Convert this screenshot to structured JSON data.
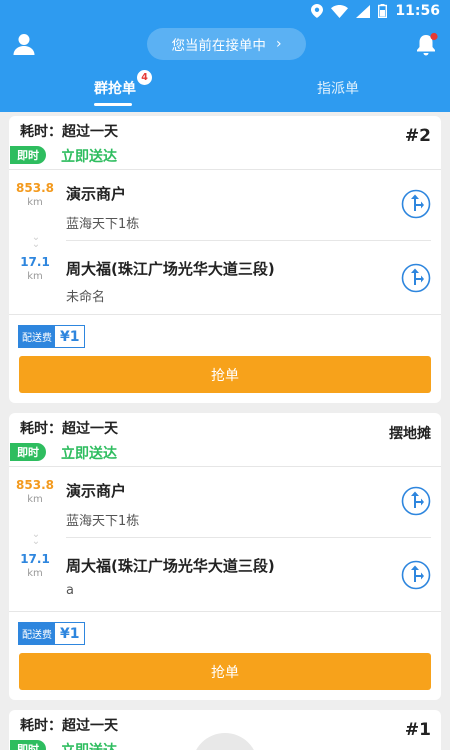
{
  "status_bar": {
    "time": "11:56"
  },
  "header": {
    "pill_text": "您当前在接单中",
    "tabs": [
      {
        "label": "群抢单",
        "badge": "4"
      },
      {
        "label": "指派单"
      }
    ]
  },
  "colors": {
    "primary": "#2e9bf0",
    "accent": "#f7a21b",
    "success": "#2ebd5f",
    "link": "#2e86de"
  },
  "orders": [
    {
      "elapsed": "耗时：超过一天",
      "tag": "#2",
      "instant_badge": "即时",
      "delivery_mode": "立即送达",
      "pickup": {
        "distance": "853.8",
        "unit": "km",
        "name": "演示商户",
        "detail": "蓝海天下1栋"
      },
      "dropoff": {
        "distance": "17.1",
        "unit": "km",
        "name": "周大福(珠江广场光华大道三段)",
        "detail": "未命名"
      },
      "fee_label": "配送费",
      "fee_value": "¥1",
      "grab_label": "抢单"
    },
    {
      "elapsed": "耗时：超过一天",
      "tag": "摆地摊",
      "instant_badge": "即时",
      "delivery_mode": "立即送达",
      "pickup": {
        "distance": "853.8",
        "unit": "km",
        "name": "演示商户",
        "detail": "蓝海天下1栋"
      },
      "dropoff": {
        "distance": "17.1",
        "unit": "km",
        "name": "周大福(珠江广场光华大道三段)",
        "detail": "a"
      },
      "fee_label": "配送费",
      "fee_value": "¥1",
      "grab_label": "抢单"
    },
    {
      "elapsed": "耗时：超过一天",
      "tag": "#1",
      "instant_badge": "即时",
      "delivery_mode": "立即送达"
    }
  ]
}
